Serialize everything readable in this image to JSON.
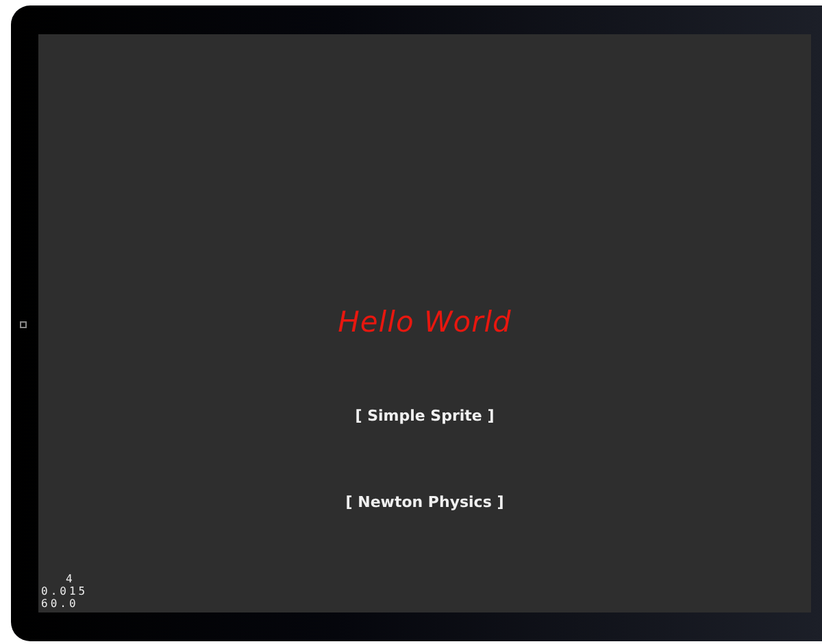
{
  "scene": {
    "title": "Hello World",
    "menu": [
      {
        "label": "[ Simple Sprite ]"
      },
      {
        "label": "[ Newton Physics ]"
      }
    ]
  },
  "stats": [
    "4",
    "0.015",
    "60.0"
  ]
}
